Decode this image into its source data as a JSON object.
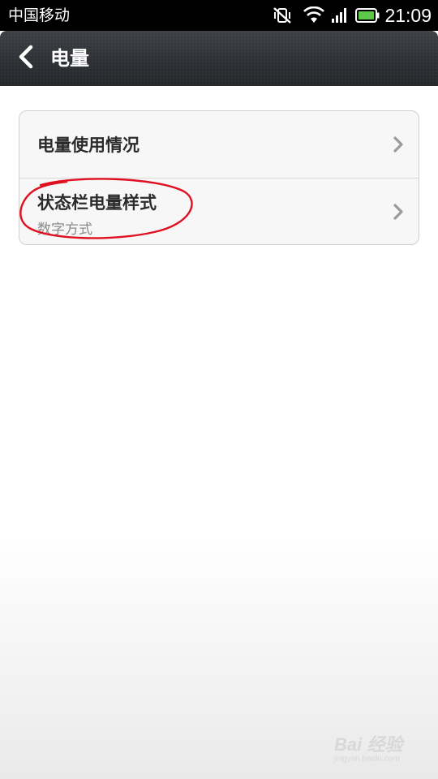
{
  "status_bar": {
    "carrier": "中国移动",
    "time": "21:09",
    "icons": [
      "vibrate-off-icon",
      "wifi-icon",
      "signal-icon",
      "battery-icon"
    ],
    "battery_color": "#5ec74a"
  },
  "title_bar": {
    "back_icon": "chevron-left-icon",
    "title": "电量"
  },
  "settings_list": {
    "items": [
      {
        "label": "电量使用情况",
        "subtitle": ""
      },
      {
        "label": "状态栏电量样式",
        "subtitle": "数字方式"
      }
    ]
  },
  "annotation": {
    "color": "#e01020",
    "shape": "hand-drawn ellipse"
  },
  "watermark": {
    "brand": "Bai 经验",
    "url": "jingyan.baidu.com"
  }
}
